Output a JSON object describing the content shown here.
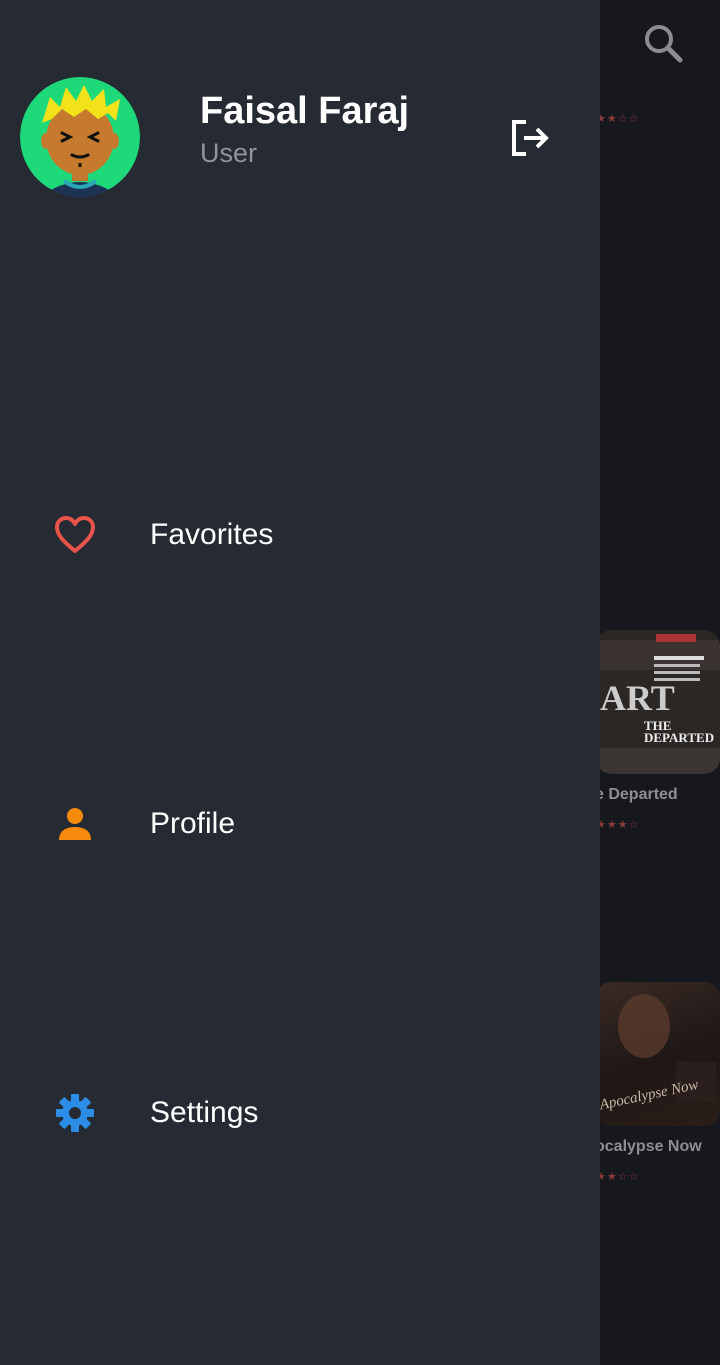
{
  "background": {
    "search_icon": "search-icon",
    "movies": [
      {
        "title_fragment": "e Departed",
        "stars": "★★★☆"
      },
      {
        "title_fragment": "ocalypse Now",
        "stars": "★★☆☆"
      }
    ],
    "top_stars": "★★☆☆"
  },
  "drawer": {
    "user": {
      "name": "Faisal Faraj",
      "role": "User"
    },
    "logout_icon": "logout-icon",
    "menu": [
      {
        "label": "Favorites",
        "icon": "heart-icon",
        "color": "#e8534a"
      },
      {
        "label": "Profile",
        "icon": "person-icon",
        "color": "#f58a0c"
      },
      {
        "label": "Settings",
        "icon": "gear-icon",
        "color": "#2b8de6"
      }
    ]
  },
  "colors": {
    "drawer_bg": "#262a33",
    "text_primary": "#ffffff",
    "text_secondary": "#8f939b",
    "avatar_bg": "#1ed97a"
  }
}
